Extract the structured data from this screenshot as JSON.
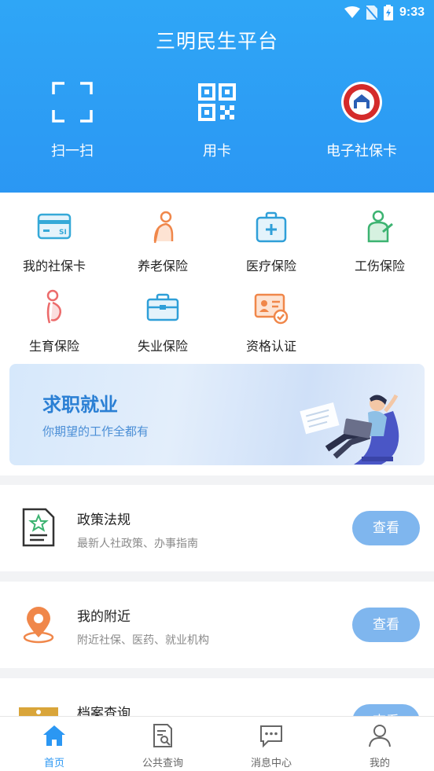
{
  "status": {
    "time": "9:33"
  },
  "app": {
    "title": "三明民生平台"
  },
  "quick_actions": [
    {
      "label": "扫一扫",
      "icon": "scan-icon"
    },
    {
      "label": "用卡",
      "icon": "qr-code-icon"
    },
    {
      "label": "电子社保卡",
      "icon": "social-security-card-logo-icon"
    }
  ],
  "services": [
    {
      "label": "我的社保卡",
      "icon": "social-security-card-icon"
    },
    {
      "label": "养老保险",
      "icon": "elderly-person-icon"
    },
    {
      "label": "医疗保险",
      "icon": "medical-kit-icon"
    },
    {
      "label": "工伤保险",
      "icon": "injured-worker-icon"
    },
    {
      "label": "生育保险",
      "icon": "pregnancy-icon"
    },
    {
      "label": "失业保险",
      "icon": "briefcase-icon"
    },
    {
      "label": "资格认证",
      "icon": "id-certification-icon"
    }
  ],
  "banner": {
    "title": "求职就业",
    "subtitle": "你期望的工作全都有"
  },
  "cards": [
    {
      "title": "政策法规",
      "subtitle": "最新人社政策、办事指南",
      "button": "查看",
      "icon": "policy-document-icon"
    },
    {
      "title": "我的附近",
      "subtitle": "附近社保、医药、就业机构",
      "button": "查看",
      "icon": "location-pin-icon"
    },
    {
      "title": "档案查询",
      "subtitle": "",
      "button": "查看",
      "icon": "archive-folder-icon"
    }
  ],
  "tabs": [
    {
      "label": "首页",
      "icon": "home-icon",
      "active": true
    },
    {
      "label": "公共查询",
      "icon": "search-document-icon",
      "active": false
    },
    {
      "label": "消息中心",
      "icon": "message-icon",
      "active": false
    },
    {
      "label": "我的",
      "icon": "user-icon",
      "active": false
    }
  ],
  "colors": {
    "primary": "#2b97f3",
    "button": "#7fb6ee",
    "orange": "#f0874a",
    "green": "#3cb371"
  }
}
